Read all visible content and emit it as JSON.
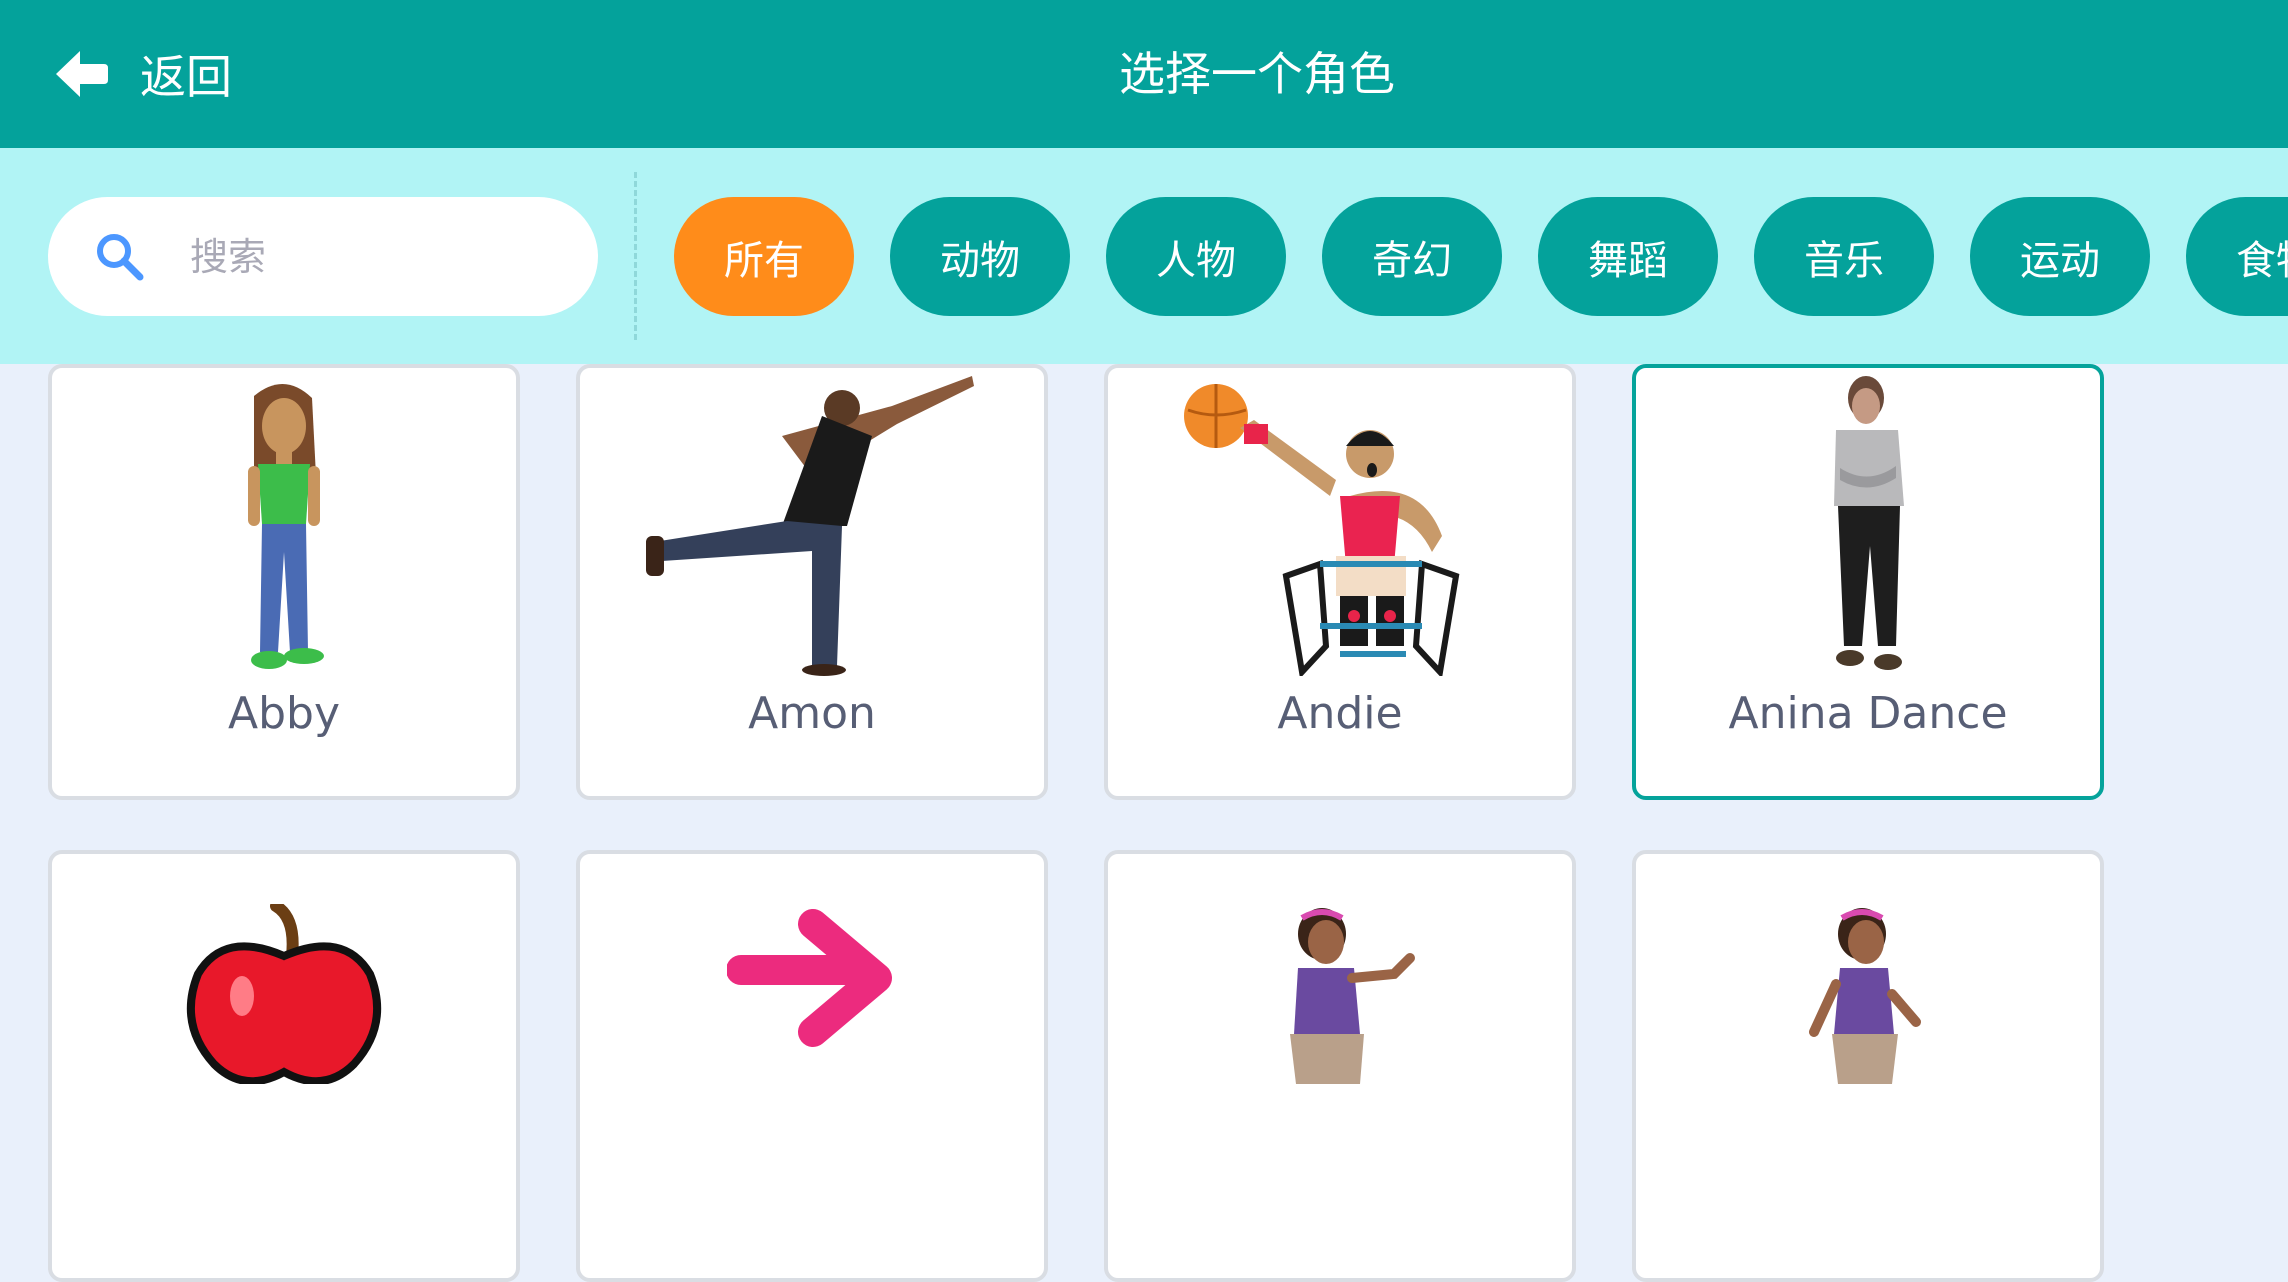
{
  "header": {
    "back_label": "返回",
    "title": "选择一个角色"
  },
  "search": {
    "placeholder": "搜索",
    "value": ""
  },
  "categories": [
    {
      "label": "所有",
      "active": true
    },
    {
      "label": "动物",
      "active": false
    },
    {
      "label": "人物",
      "active": false
    },
    {
      "label": "奇幻",
      "active": false
    },
    {
      "label": "舞蹈",
      "active": false
    },
    {
      "label": "音乐",
      "active": false
    },
    {
      "label": "运动",
      "active": false
    },
    {
      "label": "食物",
      "active": false
    }
  ],
  "sprites": [
    {
      "name": "Abby",
      "icon": "abby-sprite-icon",
      "selected": false
    },
    {
      "name": "Amon",
      "icon": "amon-sprite-icon",
      "selected": false
    },
    {
      "name": "Andie",
      "icon": "andie-sprite-icon",
      "selected": false
    },
    {
      "name": "Anina Dance",
      "icon": "anina-dance-sprite-icon",
      "selected": true
    },
    {
      "name": "",
      "icon": "apple-sprite-icon",
      "selected": false
    },
    {
      "name": "",
      "icon": "arrow-sprite-icon",
      "selected": false
    },
    {
      "name": "",
      "icon": "avery-sprite-icon",
      "selected": false
    },
    {
      "name": "",
      "icon": "avery-walking-sprite-icon",
      "selected": false
    }
  ],
  "colors": {
    "header": "#04a29b",
    "filter_bar": "#b1f4f5",
    "active_tag": "#ff8c1a",
    "tag": "#04a29b",
    "selected_border": "#05a39b"
  }
}
